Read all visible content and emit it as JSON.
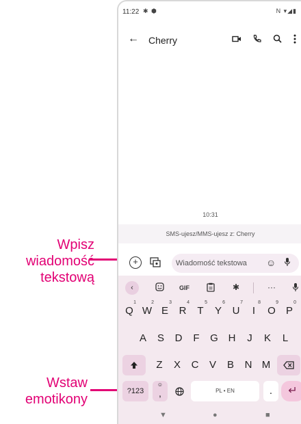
{
  "status_bar": {
    "time": "11:22",
    "left_icons": [
      "gear-icon",
      "shield-icon"
    ],
    "right_indicators": "N ▾◢▮"
  },
  "app_bar": {
    "back_icon": "back-arrow-icon",
    "title": "Cherry",
    "actions": [
      "video-call-icon",
      "phone-icon",
      "search-icon",
      "more-vert-icon"
    ]
  },
  "conversation": {
    "timestamp": "10:31",
    "info": "SMS-ujesz/MMS-ujesz z: Cherry"
  },
  "compose": {
    "placeholder": "Wiadomość tekstowa"
  },
  "keyboard": {
    "toolbar": {
      "gif": "GIF",
      "more": "···"
    },
    "row1": [
      {
        "k": "Q",
        "h": "1"
      },
      {
        "k": "W",
        "h": "2"
      },
      {
        "k": "E",
        "h": "3"
      },
      {
        "k": "R",
        "h": "4"
      },
      {
        "k": "T",
        "h": "5"
      },
      {
        "k": "Y",
        "h": "6"
      },
      {
        "k": "U",
        "h": "7"
      },
      {
        "k": "I",
        "h": "8"
      },
      {
        "k": "O",
        "h": "9"
      },
      {
        "k": "P",
        "h": "0"
      }
    ],
    "row2": [
      "A",
      "S",
      "D",
      "F",
      "G",
      "H",
      "J",
      "K",
      "L"
    ],
    "row3": [
      "Z",
      "X",
      "C",
      "V",
      "B",
      "N",
      "M"
    ],
    "symbols_key": "?123",
    "comma_key": ",",
    "space_label": "PL • EN",
    "period_key": "."
  },
  "callouts": {
    "type_message": [
      "Wpisz",
      "wiadomość",
      "tekstową"
    ],
    "insert_emoji": [
      "Wstaw",
      "emotikony"
    ],
    "color": "#e20074"
  }
}
